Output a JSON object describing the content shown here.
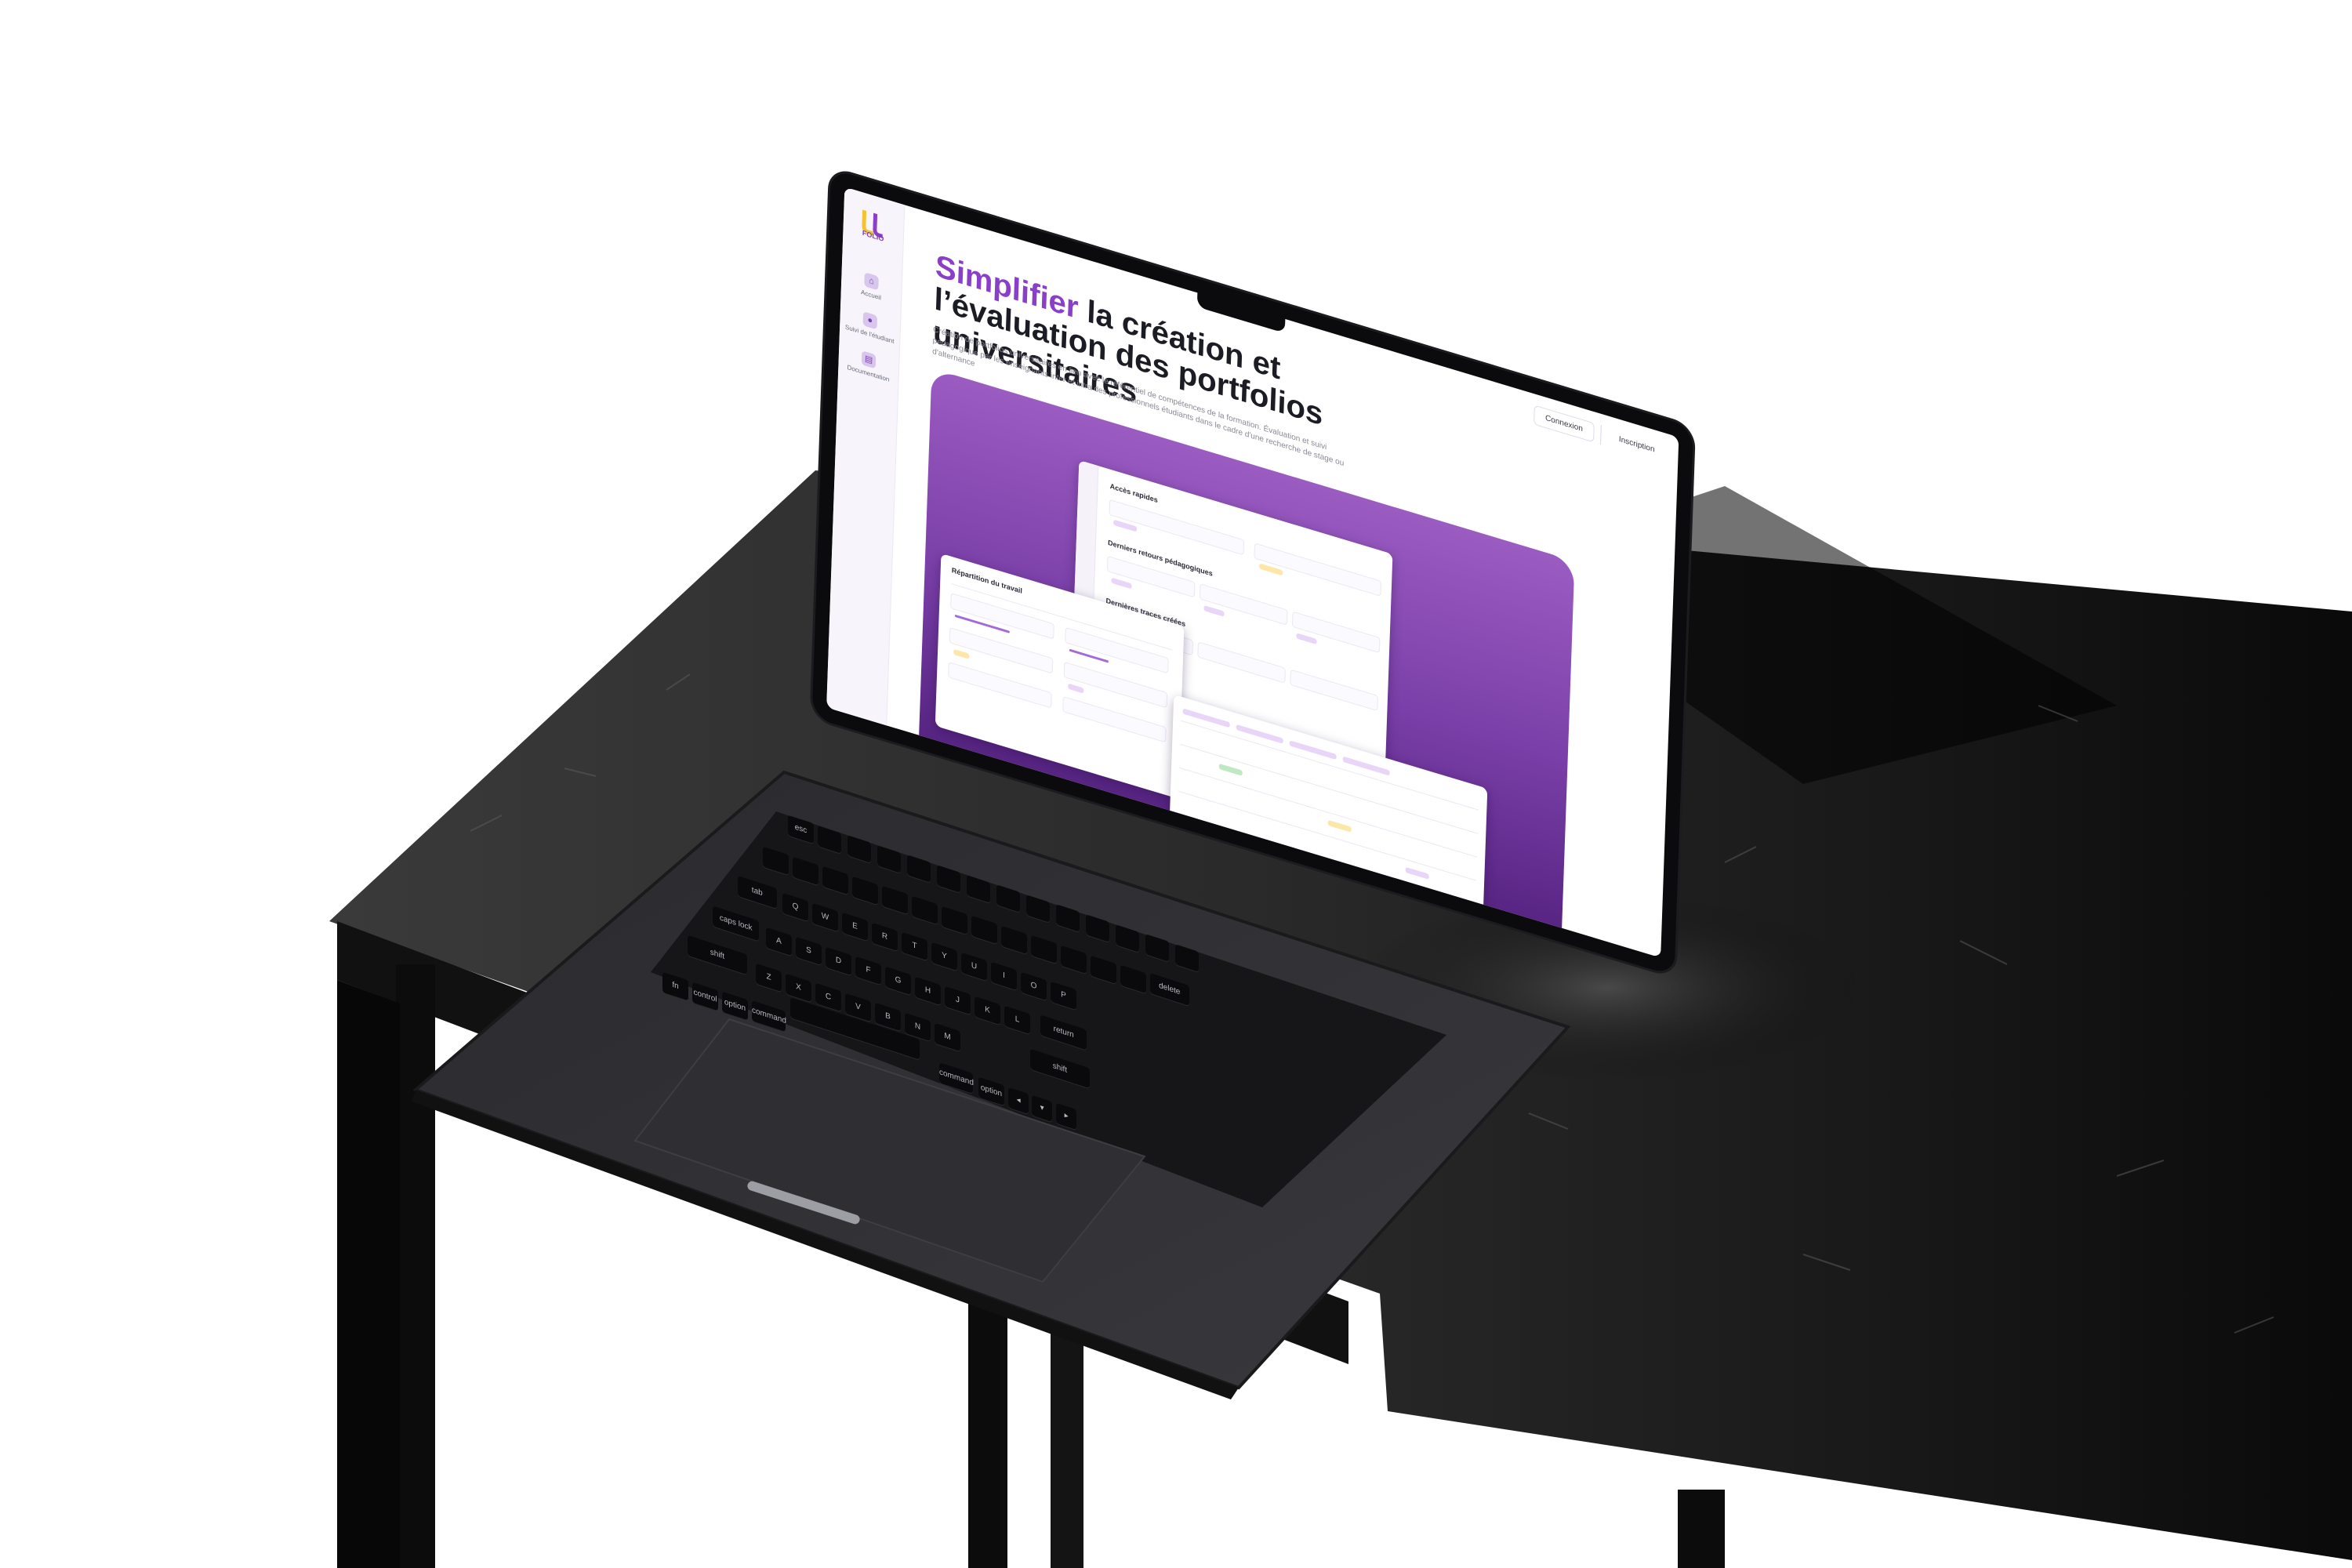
{
  "app": {
    "logo_text": "FOLIO",
    "nav": [
      {
        "label": "Accueil",
        "icon": "home-icon"
      },
      {
        "label": "Suivi de l'étudiant",
        "icon": "user-icon"
      },
      {
        "label": "Documentation",
        "icon": "doc-icon"
      }
    ],
    "header": {
      "login": "Connexion",
      "register": "Inscription"
    },
    "hero": {
      "title_accent": "Simplifier",
      "title_rest": " la création et l’évaluation des portfolios universitaires",
      "subtitle": "Création de portfolios universitaires en lien avec le référentiel de compétences de la formation. Évaluation et suivi pédagogique par les enseignants inter et intra des professionnels étudiants dans le cadre d'une recherche de stage ou d'alternance"
    },
    "showcase": {
      "card1": {
        "title": "Accès rapides",
        "section2": "Derniers retours pédagogiques",
        "section3": "Dernières traces créées"
      },
      "card2": {
        "title": "Répartition du travail"
      }
    }
  },
  "keyboard": {
    "esc": "esc",
    "tab": "tab",
    "caps": "caps lock",
    "shift": "shift",
    "fn": "fn",
    "control": "control",
    "option": "option",
    "command": "command",
    "delete": "delete",
    "return": "return",
    "shift_r": "shift",
    "command_r": "command",
    "option_r": "option",
    "letters_row1": [
      "Q",
      "W",
      "E",
      "R",
      "T",
      "Y",
      "U",
      "I",
      "O",
      "P"
    ],
    "letters_row2": [
      "A",
      "S",
      "D",
      "F",
      "G",
      "H",
      "J",
      "K",
      "L"
    ],
    "letters_row3": [
      "Z",
      "X",
      "C",
      "V",
      "B",
      "N",
      "M"
    ]
  },
  "colors": {
    "accent": "#8a3fc8",
    "showcase_top": "#9b5cc2",
    "showcase_bottom": "#4a1a74",
    "logo_yellow": "#f4c430"
  }
}
